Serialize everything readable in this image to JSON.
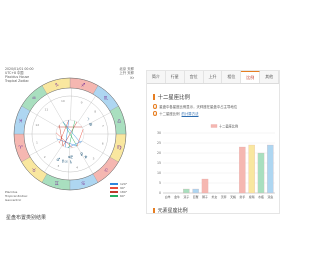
{
  "chart_panel": {
    "meta_left": [
      "2020/01/01 00:00",
      "UTC+8  中国",
      "Placidus House",
      "Tropical Zodiac"
    ],
    "meta_right": [
      "北京 天秤",
      "上升 天秤",
      "Kr"
    ],
    "legend_left": [
      "Placidus",
      "Tropical Zodiac",
      "Geocentric"
    ],
    "legend_right": [
      {
        "label": "120°",
        "color": "#2e86de"
      },
      {
        "label": "90°",
        "color": "#e74c3c"
      },
      {
        "label": "180°",
        "color": "#c0392b"
      },
      {
        "label": "60°",
        "color": "#27ae60"
      }
    ],
    "signs": [
      {
        "glyph": "♈",
        "name": "白羊",
        "color": "#f5b7b1"
      },
      {
        "glyph": "♉",
        "name": "金牛",
        "color": "#f9e79f"
      },
      {
        "glyph": "♊",
        "name": "双子",
        "color": "#a9dfbf"
      },
      {
        "glyph": "♋",
        "name": "巨蟹",
        "color": "#aed6f1"
      },
      {
        "glyph": "♌",
        "name": "狮子",
        "color": "#f5b7b1"
      },
      {
        "glyph": "♍",
        "name": "处女",
        "color": "#f9e79f"
      },
      {
        "glyph": "♎",
        "name": "天秤",
        "color": "#a9dfbf"
      },
      {
        "glyph": "♏",
        "name": "天蝎",
        "color": "#aed6f1"
      },
      {
        "glyph": "♐",
        "name": "射手",
        "color": "#f5b7b1"
      },
      {
        "glyph": "♑",
        "name": "摩羯",
        "color": "#f9e79f"
      },
      {
        "glyph": "♒",
        "name": "水瓶",
        "color": "#a9dfbf"
      },
      {
        "glyph": "♓",
        "name": "双鱼",
        "color": "#aed6f1"
      }
    ],
    "houses": [
      "1",
      "2",
      "3",
      "4",
      "5",
      "6",
      "7",
      "8",
      "9",
      "10",
      "11",
      "12"
    ]
  },
  "caption": "星盘布置类别结果",
  "info": {
    "tabs": [
      "简介",
      "行星",
      "宫位",
      "上升",
      "相位",
      "比例",
      "其他"
    ],
    "active_tab": 5,
    "section_title": "十二星座比例",
    "line1": "星盘中各星座比例显示，天秤座在星盘中占主导地位",
    "line2_prefix": "十二星座比例",
    "line2_link": "的计算方法",
    "legend_label": "十二星座比例",
    "section_title2": "元素星座比例"
  },
  "chart_data": {
    "type": "bar",
    "categories": [
      "白羊",
      "金牛",
      "双子",
      "巨蟹",
      "狮子",
      "处女",
      "天秤",
      "天蝎",
      "射手",
      "摩羯",
      "水瓶",
      "双鱼"
    ],
    "values": [
      0,
      0,
      2,
      2,
      7,
      0,
      0,
      0,
      23,
      24,
      20,
      24
    ],
    "colors": [
      "#f5b7b1",
      "#f9e79f",
      "#a9dfbf",
      "#aed6f1",
      "#f5b7b1",
      "#f9e79f",
      "#a9dfbf",
      "#aed6f1",
      "#f5b7b1",
      "#f9e79f",
      "#a9dfbf",
      "#aed6f1"
    ],
    "ylim": [
      0,
      30
    ],
    "yticks": [
      0,
      5,
      10,
      15,
      20,
      25,
      30
    ],
    "grid": true,
    "legend": "top-center"
  }
}
